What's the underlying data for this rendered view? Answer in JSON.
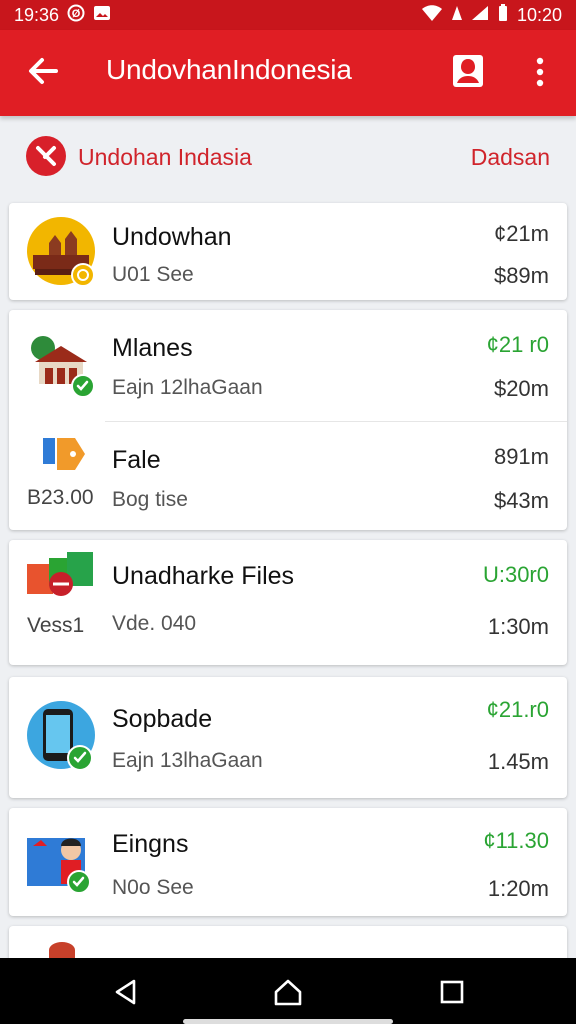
{
  "status": {
    "time": "19:36",
    "clock": "10:20"
  },
  "header": {
    "title": "UndovhanIndonesia"
  },
  "subheader": {
    "title": "Undohan Indasia",
    "action": "Dadsan"
  },
  "items": [
    {
      "title": "Undowhan",
      "subtitle": "U01 See",
      "top_value": "¢21m",
      "bottom_value": "$89m",
      "top_green": false,
      "badge": "gold",
      "left_label": ""
    },
    {
      "title": "Mlanes",
      "subtitle": "Eajn 12lhaGaan",
      "top_value": "¢21 r0",
      "bottom_value": "$20m",
      "top_green": true,
      "badge": "green",
      "left_label": ""
    },
    {
      "title": "Fale",
      "subtitle": "Bog tise",
      "top_value": "891m",
      "bottom_value": "$43m",
      "top_green": false,
      "badge": "",
      "left_label": "B23.00"
    },
    {
      "title": "Unadharke Files",
      "subtitle": "Vde. 040",
      "top_value": "U:30r0",
      "bottom_value": "1:30m",
      "top_green": true,
      "badge": "",
      "left_label": "Vess1"
    },
    {
      "title": "Sopbade",
      "subtitle": "Eajn 13lhaGaan",
      "top_value": "¢21.r0",
      "bottom_value": "1.45m",
      "top_green": true,
      "badge": "green",
      "left_label": ""
    },
    {
      "title": "Eingns",
      "subtitle": "N0o See",
      "top_value": "¢11.30",
      "bottom_value": "1:20m",
      "top_green": true,
      "badge": "green",
      "left_label": ""
    }
  ],
  "icons": {
    "back": "arrow-left-icon",
    "profile": "profile-icon",
    "more": "more-vert-icon",
    "nav_back": "triangle-back-icon",
    "nav_home": "home-icon",
    "nav_recent": "square-recent-icon"
  },
  "colors": {
    "primary": "#e01e24",
    "accent_green": "#2aa433",
    "gold": "#f2b600"
  }
}
